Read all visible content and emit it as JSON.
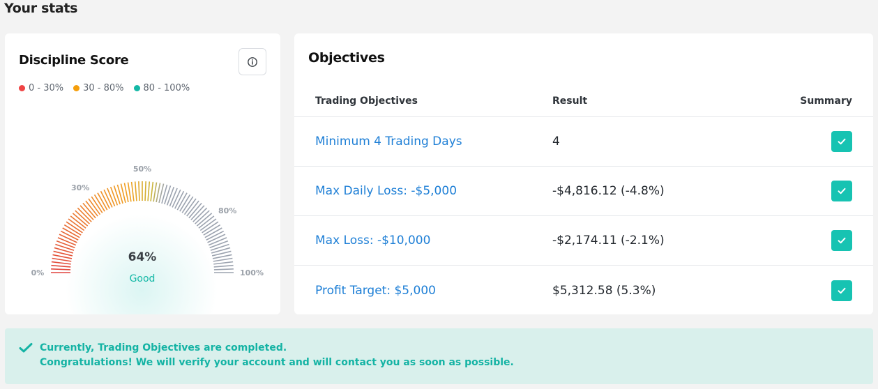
{
  "page": {
    "heading": "Your stats"
  },
  "discipline": {
    "title": "Discipline Score",
    "info_icon": "info-circle-icon",
    "legend": [
      {
        "label": "0 - 30%",
        "color": "#ef4444"
      },
      {
        "label": "30 - 80%",
        "color": "#f59e0b"
      },
      {
        "label": "80 - 100%",
        "color": "#14b8a6"
      }
    ],
    "gauge": {
      "value_percent": 64,
      "value_text": "64%",
      "status": "Good",
      "status_color": "#14b8a6",
      "tick_labels": [
        "0%",
        "30%",
        "50%",
        "80%",
        "100%"
      ],
      "gradient_colors": [
        "#e0443e",
        "#ee8a2c",
        "#f0a020",
        "#c9b43a",
        "#9ca3af"
      ]
    }
  },
  "objectives": {
    "title": "Objectives",
    "headers": {
      "objective": "Trading Objectives",
      "result": "Result",
      "summary": "Summary"
    },
    "rows": [
      {
        "objective": "Minimum 4 Trading Days",
        "result": "4",
        "passed": true
      },
      {
        "objective": "Max Daily Loss: -$5,000",
        "result": "-$4,816.12 (-4.8%)",
        "passed": true
      },
      {
        "objective": "Max Loss: -$10,000",
        "result": "-$2,174.11 (-2.1%)",
        "passed": true
      },
      {
        "objective": "Profit Target: $5,000",
        "result": "$5,312.58 (5.3%)",
        "passed": true
      }
    ],
    "check_icon": "check-icon",
    "check_color": "#17c3b2"
  },
  "banner": {
    "icon": "check-icon",
    "line1": "Currently, Trading Objectives are completed.",
    "line2": "Congratulations! We will verify your account and will contact you as soon as possible."
  }
}
